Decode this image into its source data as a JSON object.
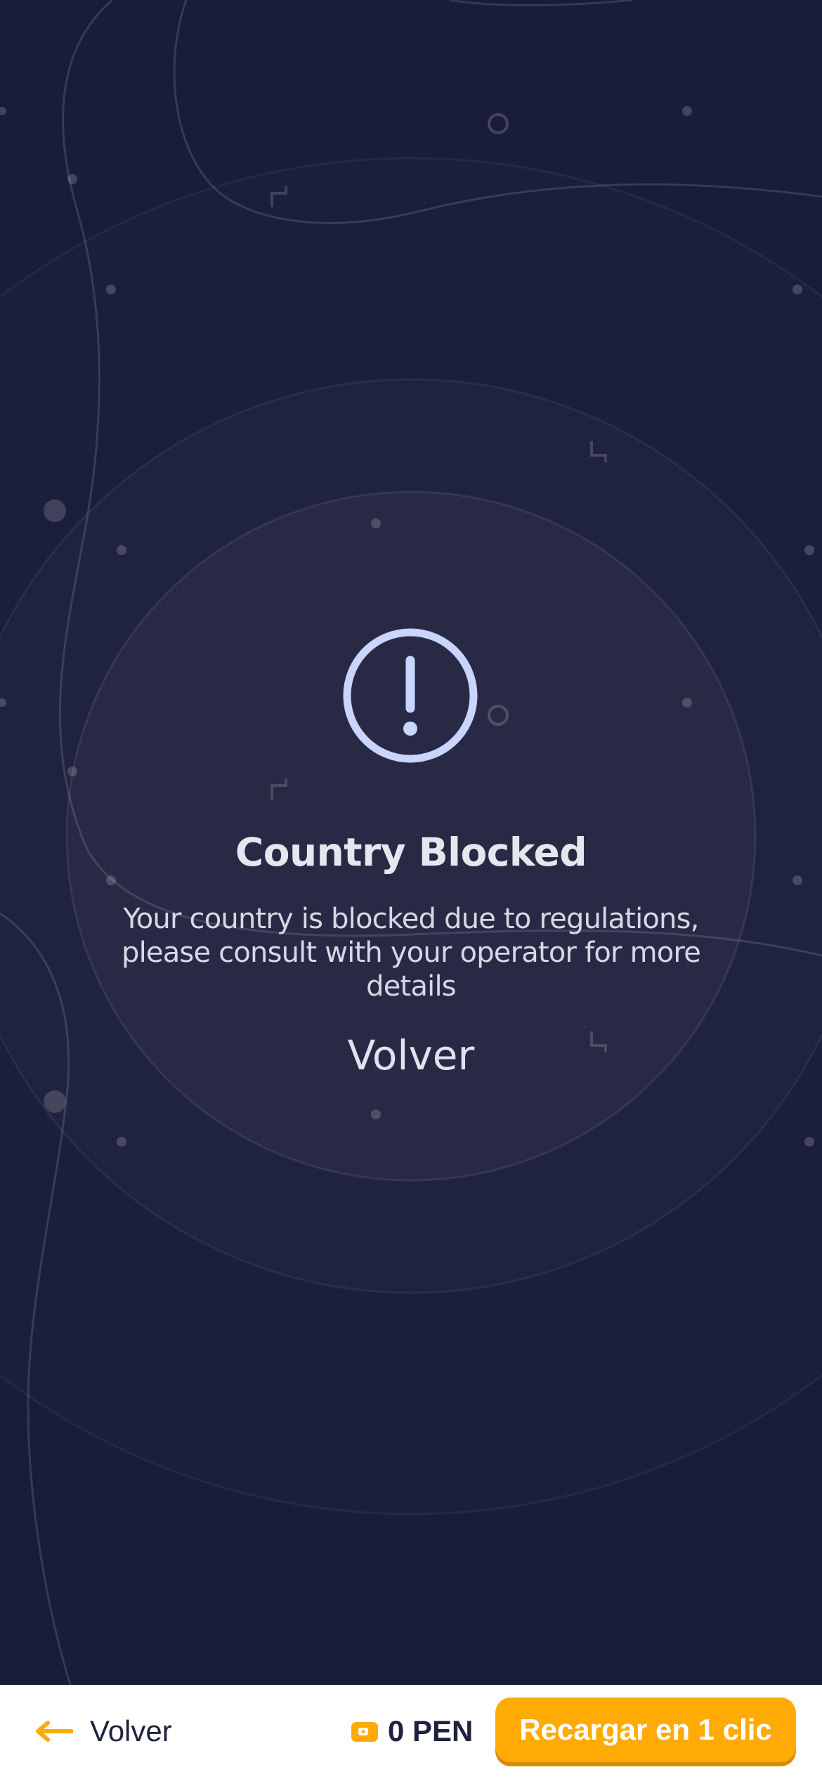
{
  "colors": {
    "background": "#1a1d3a",
    "accent": "#ffaa05",
    "icon": "#c9d4ff",
    "bottom_bar": "#ffffff",
    "bottom_text": "#1f2140"
  },
  "dialog": {
    "icon": "exclamation-circle-icon",
    "title": "Country Blocked",
    "message": "Your country is blocked due to regulations, please consult with your operator for more details",
    "back_label": "Volver"
  },
  "bottom_bar": {
    "back_icon": "arrow-left-icon",
    "back_label": "Volver",
    "wallet_icon": "wallet-icon",
    "balance": "0 PEN",
    "recharge_label": "Recargar en 1 clic"
  }
}
